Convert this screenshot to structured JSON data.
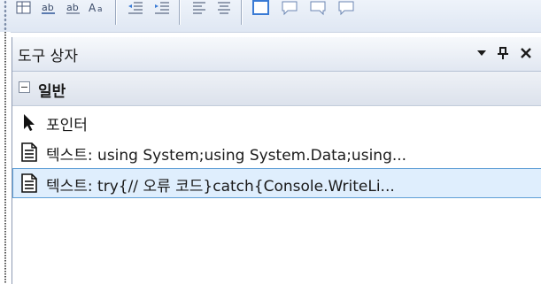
{
  "toolbox": {
    "title": "도구 상자",
    "group": {
      "label": "일반",
      "expander_icon": "collapse-minus-icon"
    },
    "items": [
      {
        "label": "포인터",
        "icon": "pointer-arrow-icon"
      },
      {
        "label": "텍스트: using System;using System.Data;using...",
        "icon": "text-document-icon"
      },
      {
        "label": "텍스트: try{// 오류 코드}catch{Console.WriteLi...",
        "icon": "text-document-icon"
      }
    ],
    "selected_index": 2
  },
  "colors": {
    "selection_fill": "#dfeefd",
    "selection_border": "#5e9ed6",
    "title_gradient_top": "#f7f9fc",
    "title_gradient_bottom": "#e1e7f1"
  }
}
